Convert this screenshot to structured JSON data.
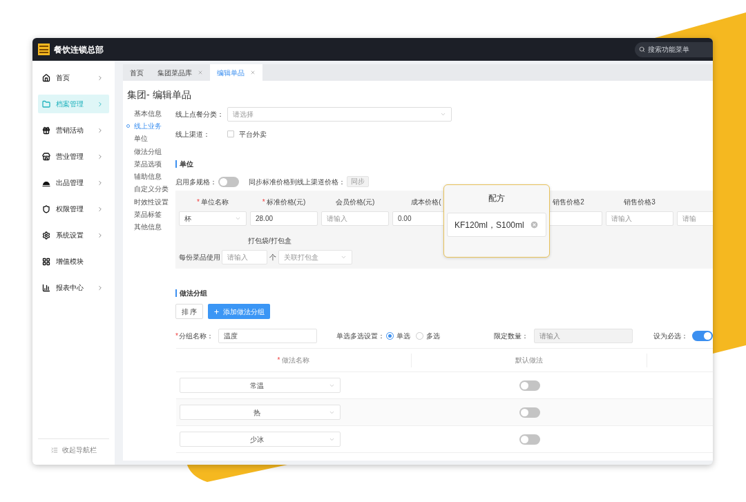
{
  "header": {
    "title": "餐饮连锁总部",
    "search": {
      "placeholder": "搜索功能菜单"
    }
  },
  "sidebar": {
    "items": [
      {
        "label": "首页",
        "expandable": true,
        "selected": false
      },
      {
        "label": "档案管理",
        "expandable": true,
        "selected": true
      },
      {
        "label": "营销活动",
        "expandable": true,
        "selected": false
      },
      {
        "label": "营业管理",
        "expandable": true,
        "selected": false
      },
      {
        "label": "出品管理",
        "expandable": true,
        "selected": false
      },
      {
        "label": "权限管理",
        "expandable": true,
        "selected": false
      },
      {
        "label": "系统设置",
        "expandable": true,
        "selected": false
      },
      {
        "label": "增值模块",
        "expandable": false,
        "selected": false
      },
      {
        "label": "报表中心",
        "expandable": true,
        "selected": false
      }
    ],
    "collapse": "收起导航栏"
  },
  "tabs": [
    {
      "label": "首页",
      "closable": false,
      "selected": false
    },
    {
      "label": "集团菜品库",
      "closable": true,
      "selected": false
    },
    {
      "label": "编辑单品",
      "closable": true,
      "selected": true
    }
  ],
  "page_title": "集团- 编辑单品",
  "anchors": [
    {
      "label": "基本信息",
      "selected": false
    },
    {
      "label": "线上业务",
      "selected": true
    },
    {
      "label": "单位",
      "selected": false
    },
    {
      "label": "做法分组",
      "selected": false
    },
    {
      "label": "菜品选项",
      "selected": false
    },
    {
      "label": "辅助信息",
      "selected": false
    },
    {
      "label": "自定义分类",
      "selected": false
    },
    {
      "label": "时效性设置",
      "selected": false
    },
    {
      "label": "菜品标签",
      "selected": false
    },
    {
      "label": "其他信息",
      "selected": false
    }
  ],
  "online": {
    "category_label": "线上点餐分类：",
    "category_placeholder": "请选择",
    "channel_label": "线上渠道：",
    "channel_option": {
      "label": "平台外卖",
      "checked": false
    }
  },
  "unit_section": {
    "title": "单位",
    "multi_spec_label": "启用多规格：",
    "multi_spec_on": false,
    "sync_label": "同步标准价格到线上渠道价格：",
    "sync_button": "同步",
    "columns": [
      {
        "label": "单位名称",
        "required_mark": "*",
        "kind": "select",
        "value": "杯"
      },
      {
        "label": "标准价格(元)",
        "required_mark": "*",
        "kind": "input",
        "value": "28.00"
      },
      {
        "label": "会员价格(元)",
        "kind": "input",
        "placeholder": "请输入"
      },
      {
        "label": "成本价格(",
        "kind": "input",
        "value": "0.00"
      },
      {
        "kind": "hidden"
      },
      {
        "label": "销售价格2",
        "kind": "input"
      },
      {
        "label": "销售价格3",
        "kind": "input",
        "placeholder": "请输入"
      },
      {
        "kind": "input",
        "placeholder": "请输"
      }
    ],
    "packaging": {
      "header": "打包袋/打包盒",
      "label": "每份菜品使用",
      "qty_placeholder": "请输入",
      "unit": "个",
      "box_placeholder": "关联打包盒"
    }
  },
  "recipe_popup": {
    "title": "配方",
    "value": "KF120ml，S100ml"
  },
  "method_section": {
    "title": "做法分组",
    "sort_button": "排 序",
    "add_button": "添加做法分组",
    "group_name_mark": "*",
    "group_name_label": "分组名称：",
    "group_name_value": "温度",
    "selection_label": "单选多选设置：",
    "selection_options": [
      {
        "label": "单选",
        "selected": true
      },
      {
        "label": "多选",
        "selected": false
      }
    ],
    "limit_label": "限定数量：",
    "limit_placeholder": "请输入",
    "required_label": "设为必选：",
    "required_on": true,
    "table": {
      "columns": [
        {
          "label": "做法名称",
          "required_mark": "*"
        },
        {
          "label": "默认做法"
        }
      ],
      "rows": [
        {
          "name": "常温",
          "default": false
        },
        {
          "name": "热",
          "default": false
        },
        {
          "name": "少冰",
          "default": false
        }
      ]
    }
  }
}
